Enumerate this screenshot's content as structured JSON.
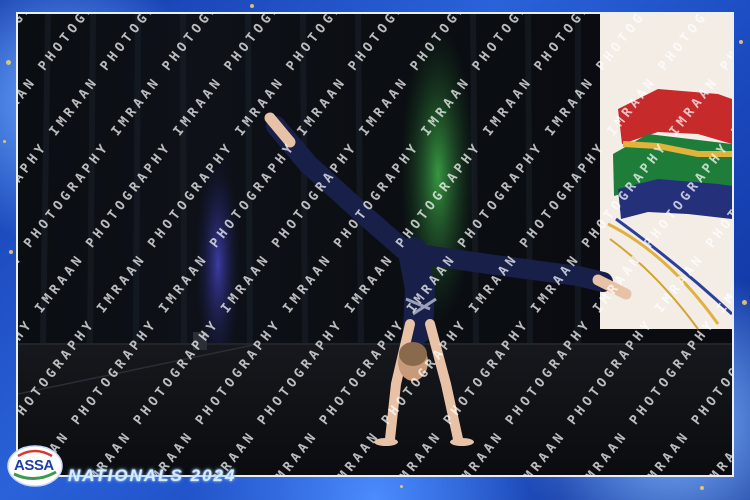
{
  "photo": {
    "subject": "gymnast",
    "watermark_text": "IMRAAN PHOTOGRAPHY",
    "colors": {
      "curtain": "#0b0f14",
      "floor": "#111318",
      "leotard": "#18204a",
      "green_light": "#2f8f3a",
      "blue_light": "#3a3aa8"
    }
  },
  "branding": {
    "logo_text": "ASSA",
    "event_title": "NATIONALS 2024"
  }
}
